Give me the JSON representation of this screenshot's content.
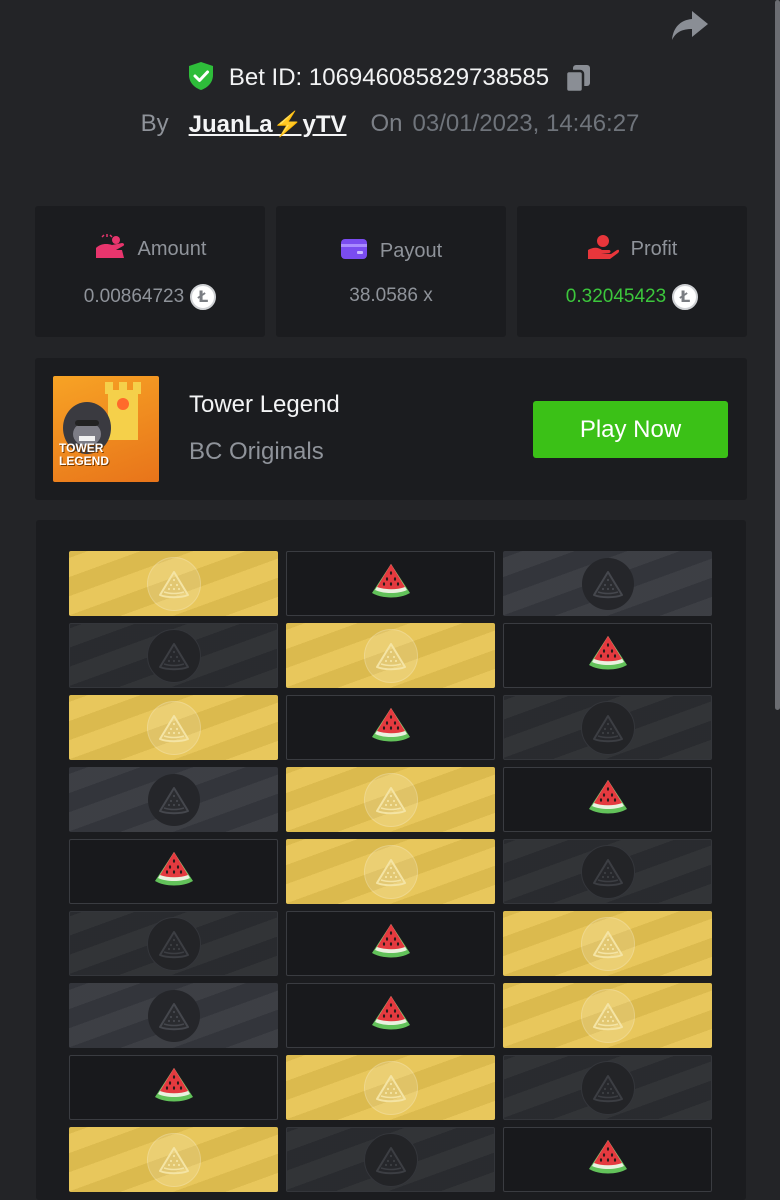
{
  "header": {
    "bet_id": "Bet ID: 106946085829738585",
    "by_label": "By",
    "username": "JuanLa⚡yTV",
    "on_label": "On",
    "datetime": "03/01/2023, 14:46:27"
  },
  "stats": {
    "amount": {
      "label": "Amount",
      "value": "0.00864723",
      "coin": "Ł"
    },
    "payout": {
      "label": "Payout",
      "value": "38.0586 x"
    },
    "profit": {
      "label": "Profit",
      "value": "0.32045423",
      "coin": "Ł"
    }
  },
  "game": {
    "title": "Tower Legend",
    "subtitle": "BC Originals",
    "thumb_text_line1": "TOWER",
    "thumb_text_line2": "LEGEND",
    "play_label": "Play Now"
  },
  "board": {
    "rows": [
      [
        "gold",
        "melon",
        "gray"
      ],
      [
        "dark",
        "gold",
        "melon"
      ],
      [
        "gold",
        "melon",
        "dark"
      ],
      [
        "gray",
        "gold",
        "melon"
      ],
      [
        "melon",
        "gold",
        "dark"
      ],
      [
        "dark",
        "melon",
        "gold"
      ],
      [
        "gray",
        "melon",
        "gold"
      ],
      [
        "melon",
        "gold",
        "dark"
      ],
      [
        "gold",
        "dark",
        "melon"
      ]
    ]
  },
  "colors": {
    "accent_green": "#3bc117",
    "profit_green": "#3cc73c",
    "gold_tile": "#e7c452",
    "shield_green": "#2ebd3a",
    "amount_icon": "#e8356d",
    "payout_icon": "#7a4cf0",
    "profit_icon": "#e8363b"
  },
  "icons": {
    "share": "share-arrow-icon",
    "shield": "shield-check-icon",
    "copy": "copy-icon",
    "amount": "amount-icon",
    "payout": "wallet-icon",
    "profit": "hand-coin-icon",
    "coin": "litecoin-icon",
    "tile_emblem": "watermelon-slice-outline-icon",
    "melon": "watermelon-icon"
  }
}
